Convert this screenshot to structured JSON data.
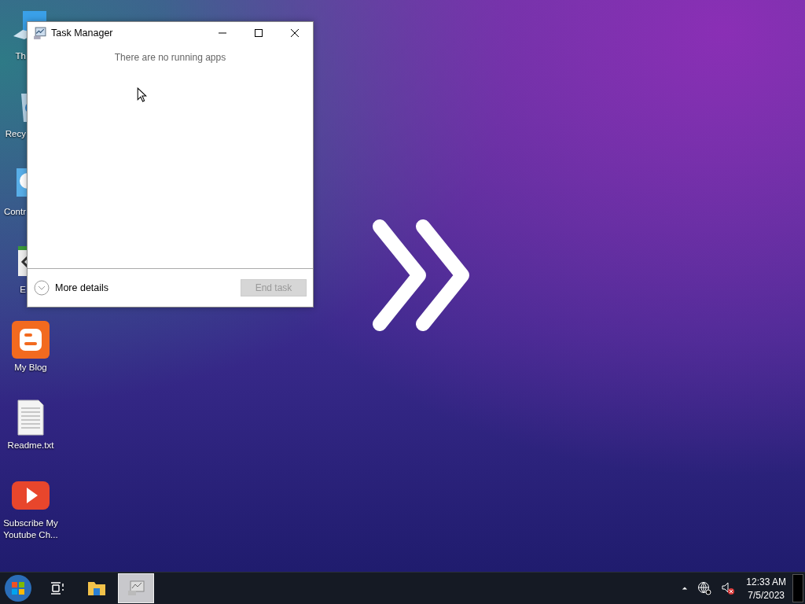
{
  "window": {
    "title": "Task Manager",
    "message": "There are no running apps",
    "more_details": "More details",
    "end_task": {
      "label": "End task",
      "disabled": true
    }
  },
  "desktop_icons": [
    {
      "kind": "computer",
      "label": "Th",
      "cut": true
    },
    {
      "kind": "recycle",
      "label": "Recy",
      "cut": true
    },
    {
      "kind": "control",
      "label": "Contr",
      "cut": true
    },
    {
      "kind": "code",
      "label": "E",
      "cut": true
    },
    {
      "kind": "blog",
      "label": "My Blog",
      "cut": false
    },
    {
      "kind": "text",
      "label": "Readme.txt",
      "cut": false
    },
    {
      "kind": "video",
      "label": "Subscribe My Youtube Ch...",
      "cut": false
    }
  ],
  "taskbar": {
    "items": [
      {
        "kind": "start",
        "selected": false
      },
      {
        "kind": "task-view",
        "selected": false
      },
      {
        "kind": "explorer",
        "selected": false
      },
      {
        "kind": "task-manager",
        "selected": true
      }
    ],
    "tray": {
      "time": "12:33 AM",
      "date": "7/5/2023"
    }
  }
}
